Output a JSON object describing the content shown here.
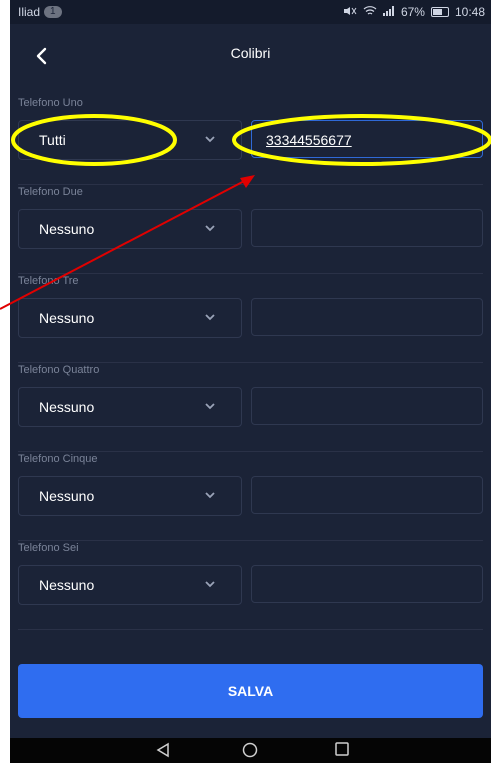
{
  "status_bar": {
    "carrier": "Iliad",
    "badge": "1",
    "battery_percent": "67%",
    "time": "10:48",
    "battery_level": 0.67
  },
  "app_bar": {
    "back_icon": "chevron-left-icon",
    "title": "Colibri"
  },
  "phones": [
    {
      "label": "Telefono Uno",
      "select_value": "Tutti",
      "number": "33344556677"
    },
    {
      "label": "Telefono Due",
      "select_value": "Nessuno",
      "number": ""
    },
    {
      "label": "Telefono Tre",
      "select_value": "Nessuno",
      "number": ""
    },
    {
      "label": "Telefono Quattro",
      "select_value": "Nessuno",
      "number": ""
    },
    {
      "label": "Telefono Cinque",
      "select_value": "Nessuno",
      "number": ""
    },
    {
      "label": "Telefono Sei",
      "select_value": "Nessuno",
      "number": ""
    }
  ],
  "save_button": {
    "label": "SALVA"
  },
  "colors": {
    "background": "#1b2337",
    "accent": "#2f6df0",
    "annotation_circle": "#ffff00",
    "annotation_arrow": "#e00000"
  }
}
